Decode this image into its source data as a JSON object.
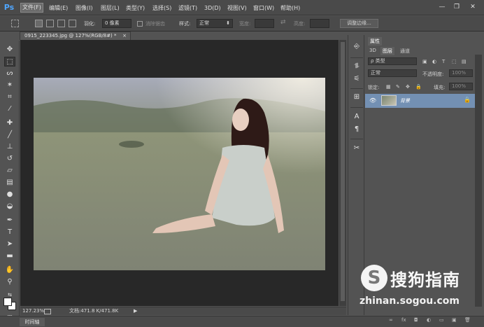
{
  "app": {
    "logo": "Ps"
  },
  "menu": {
    "items": [
      "文件(F)",
      "编辑(E)",
      "图像(I)",
      "图层(L)",
      "类型(Y)",
      "选择(S)",
      "滤镜(T)",
      "3D(D)",
      "视图(V)",
      "窗口(W)",
      "帮助(H)"
    ],
    "active_index": 0
  },
  "window_controls": {
    "minimize": "—",
    "restore": "❐",
    "close": "✕"
  },
  "options": {
    "feather_label": "羽化:",
    "feather_value": "0 像素",
    "antialias_label": "消除锯齿",
    "style_label": "样式:",
    "style_value": "正常",
    "width_label": "宽度:",
    "height_label": "高度:",
    "refine_button": "调整边缘..."
  },
  "document": {
    "tab_title": "0915_223345.jpg @ 127%(RGB/8#) *",
    "close": "×",
    "zoom": "127.23%",
    "doc_info": "文档:471.8 K/471.8K"
  },
  "timeline": {
    "label": "时间轴"
  },
  "panels": {
    "top_tab": "属性",
    "tabs": [
      "3D",
      "图层",
      "通道"
    ],
    "active_tab": 1,
    "filter_label": "ρ 类型",
    "blend_mode": "正常",
    "opacity_label": "不透明度:",
    "opacity_value": "100%",
    "lock_label": "锁定:",
    "fill_label": "填充:",
    "fill_value": "100%",
    "layer_name": "背景",
    "footer_icons": [
      "∞",
      "fx",
      "◘",
      "◐",
      "▭",
      "▣",
      "🗑"
    ]
  },
  "watermark": {
    "logo_letter": "S",
    "title": "搜狗指南",
    "url": "zhinan.sogou.com"
  },
  "colors": {
    "selected_layer": "#7390b3",
    "ps_blue": "#4fa6ff",
    "canvas_bg": "#282828"
  }
}
